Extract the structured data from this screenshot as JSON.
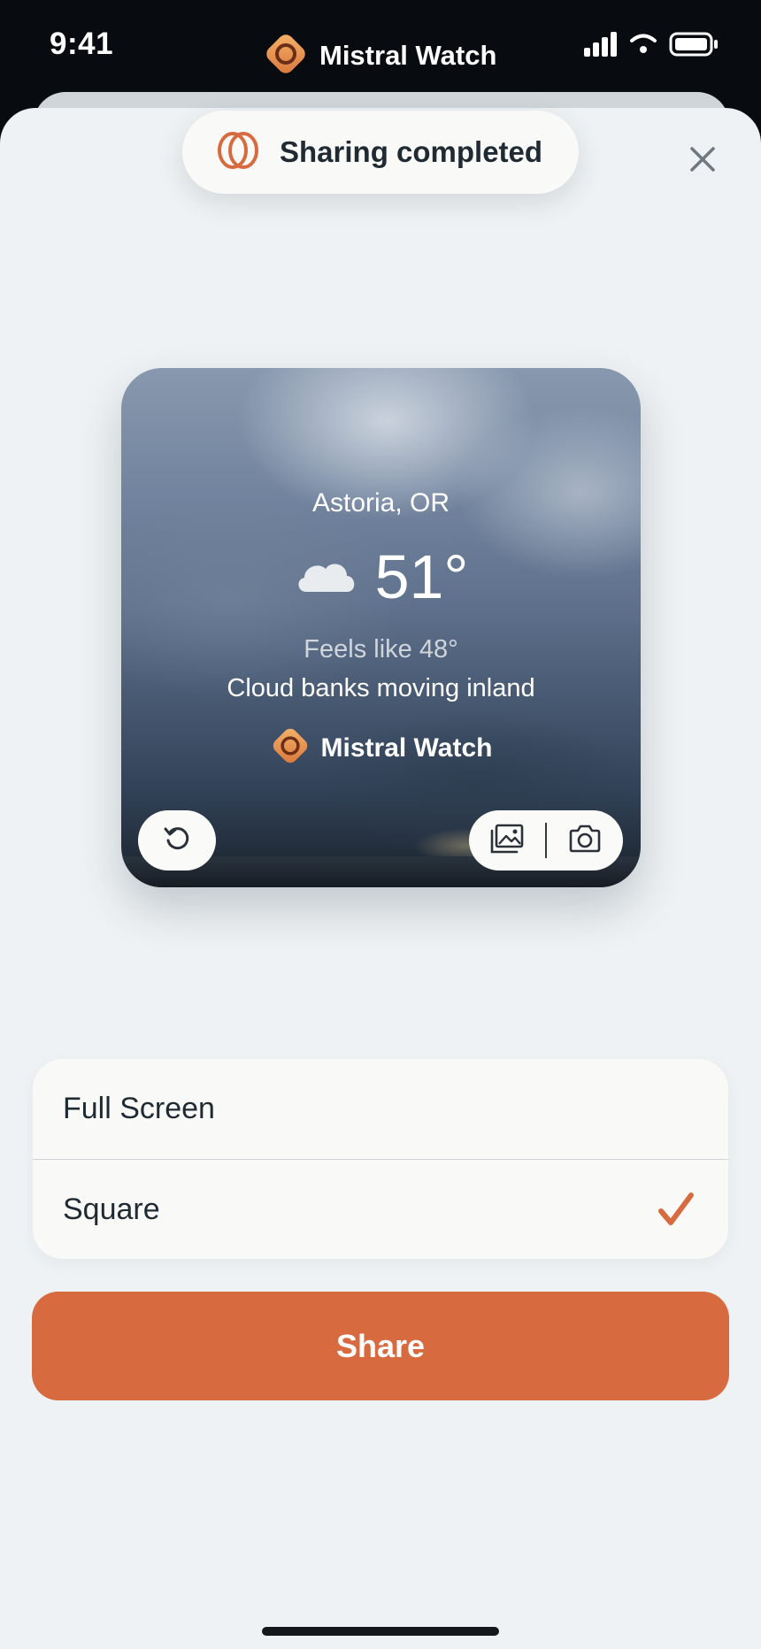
{
  "status_bar": {
    "time": "9:41",
    "app_name": "Mistral Watch",
    "icons": [
      "signal-icon",
      "wifi-icon",
      "battery-icon"
    ]
  },
  "toast": {
    "text": "Sharing completed",
    "icon": "share-loop-icon"
  },
  "close_icon": "close-icon",
  "preview": {
    "location": "Astoria, OR",
    "condition_icon": "cloud-icon",
    "temperature": "51°",
    "feels_like": "Feels like 48°",
    "condition": "Cloud banks moving inland",
    "brand": "Mistral Watch",
    "controls": [
      "undo-icon",
      "gallery-icon",
      "camera-icon"
    ]
  },
  "options": [
    {
      "label": "Full Screen",
      "selected": false
    },
    {
      "label": "Square",
      "selected": true
    }
  ],
  "share_button": {
    "label": "Share"
  },
  "colors": {
    "accent": "#d86a3f",
    "sheet_background": "#eef2f4",
    "surface": "#f9faf8",
    "text_primary": "#1f2a33"
  }
}
